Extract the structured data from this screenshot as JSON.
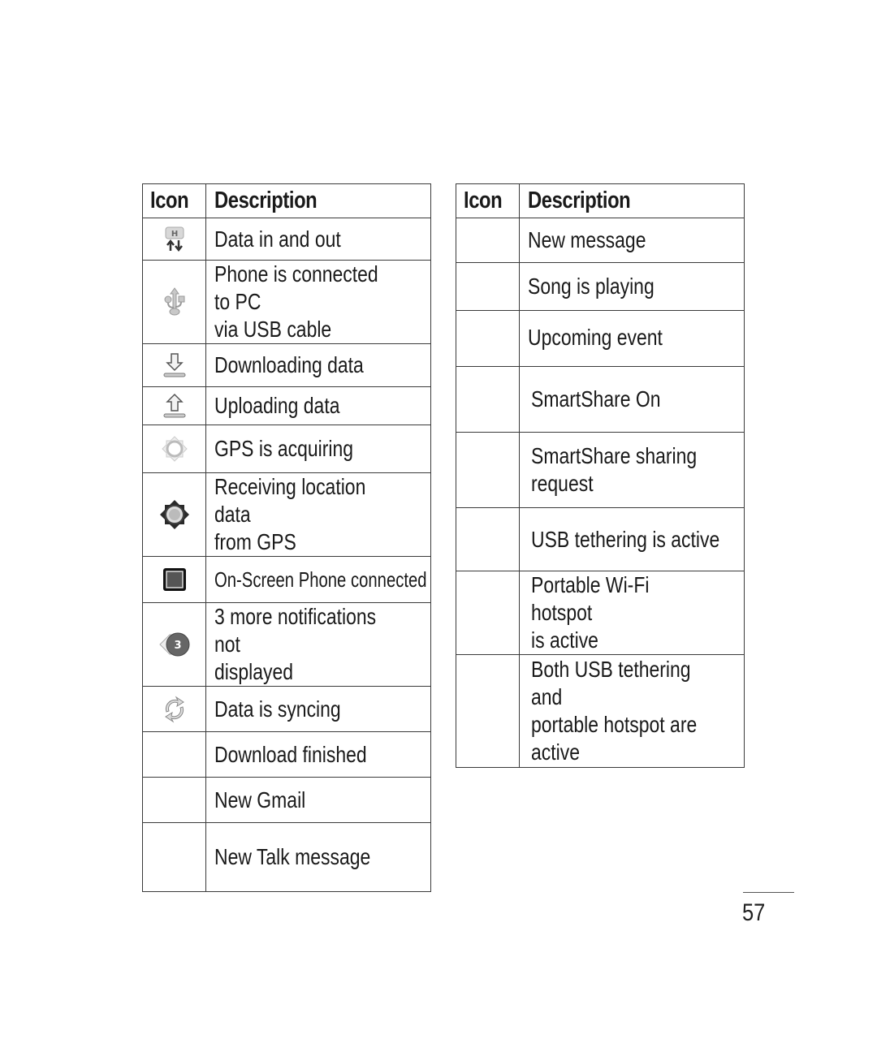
{
  "left_table": {
    "headers": {
      "icon": "Icon",
      "description": "Description"
    },
    "rows": [
      {
        "icon": "data-in-out-icon",
        "description": "Data in and out"
      },
      {
        "icon": "usb-icon",
        "description": "Phone is connected to PC\nvia USB cable"
      },
      {
        "icon": "download-icon",
        "description": "Downloading data"
      },
      {
        "icon": "upload-icon",
        "description": "Uploading data"
      },
      {
        "icon": "gps-acquiring-icon",
        "description": "GPS is acquiring"
      },
      {
        "icon": "gps-receiving-icon",
        "description": "Receiving location data\nfrom GPS"
      },
      {
        "icon": "on-screen-phone-icon",
        "description": "On-Screen Phone connected"
      },
      {
        "icon": "more-notifications-icon",
        "badge": "3",
        "description": "3 more notifications not\ndisplayed"
      },
      {
        "icon": "sync-icon",
        "description": "Data is syncing"
      },
      {
        "icon": "",
        "description": "Download finished"
      },
      {
        "icon": "",
        "description": "New Gmail"
      },
      {
        "icon": "",
        "description": "New Talk message"
      }
    ]
  },
  "right_table": {
    "headers": {
      "icon": "Icon",
      "description": "Description"
    },
    "rows": [
      {
        "icon": "",
        "description": "New message"
      },
      {
        "icon": "",
        "description": "Song is playing"
      },
      {
        "icon": "",
        "description": "Upcoming event"
      },
      {
        "icon": "",
        "description": "SmartShare On"
      },
      {
        "icon": "",
        "description": "SmartShare sharing\nrequest"
      },
      {
        "icon": "",
        "description": "USB tethering is active"
      },
      {
        "icon": "",
        "description": "Portable Wi-Fi hotspot\nis active"
      },
      {
        "icon": "",
        "description": "Both USB tethering and\nportable hotspot are\nactive"
      }
    ]
  },
  "page_number": "57"
}
